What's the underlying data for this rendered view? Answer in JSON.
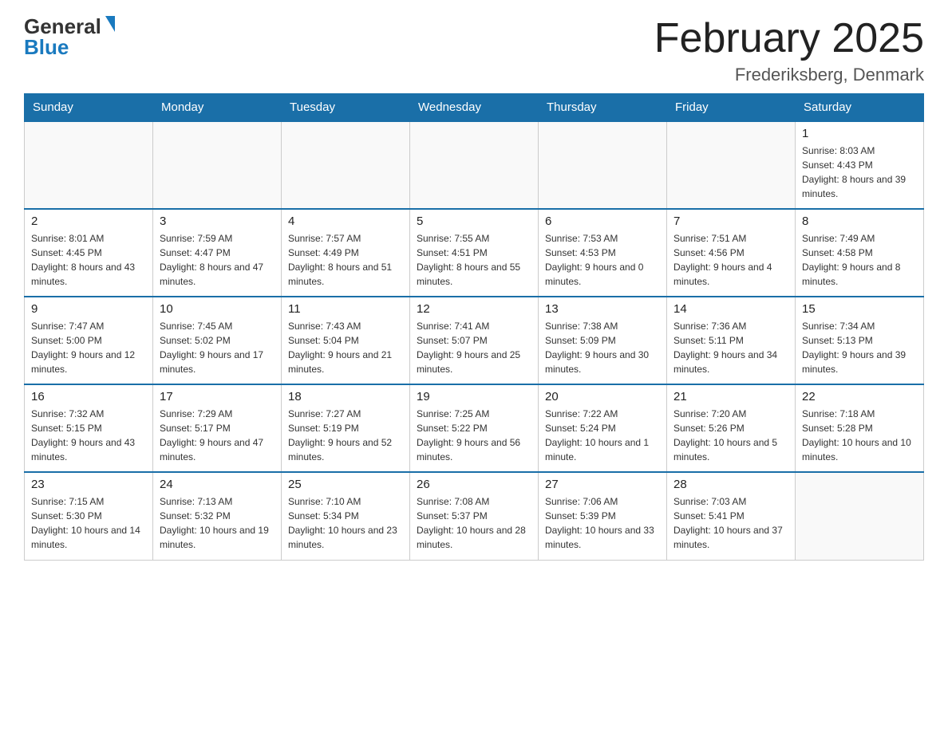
{
  "logo": {
    "general": "General",
    "blue": "Blue",
    "triangle": "▼"
  },
  "header": {
    "month_year": "February 2025",
    "location": "Frederiksberg, Denmark"
  },
  "days_of_week": [
    "Sunday",
    "Monday",
    "Tuesday",
    "Wednesday",
    "Thursday",
    "Friday",
    "Saturday"
  ],
  "weeks": [
    [
      {
        "day": "",
        "sunrise": "",
        "sunset": "",
        "daylight": "",
        "empty": true
      },
      {
        "day": "",
        "sunrise": "",
        "sunset": "",
        "daylight": "",
        "empty": true
      },
      {
        "day": "",
        "sunrise": "",
        "sunset": "",
        "daylight": "",
        "empty": true
      },
      {
        "day": "",
        "sunrise": "",
        "sunset": "",
        "daylight": "",
        "empty": true
      },
      {
        "day": "",
        "sunrise": "",
        "sunset": "",
        "daylight": "",
        "empty": true
      },
      {
        "day": "",
        "sunrise": "",
        "sunset": "",
        "daylight": "",
        "empty": true
      },
      {
        "day": "1",
        "sunrise": "Sunrise: 8:03 AM",
        "sunset": "Sunset: 4:43 PM",
        "daylight": "Daylight: 8 hours and 39 minutes.",
        "empty": false
      }
    ],
    [
      {
        "day": "2",
        "sunrise": "Sunrise: 8:01 AM",
        "sunset": "Sunset: 4:45 PM",
        "daylight": "Daylight: 8 hours and 43 minutes.",
        "empty": false
      },
      {
        "day": "3",
        "sunrise": "Sunrise: 7:59 AM",
        "sunset": "Sunset: 4:47 PM",
        "daylight": "Daylight: 8 hours and 47 minutes.",
        "empty": false
      },
      {
        "day": "4",
        "sunrise": "Sunrise: 7:57 AM",
        "sunset": "Sunset: 4:49 PM",
        "daylight": "Daylight: 8 hours and 51 minutes.",
        "empty": false
      },
      {
        "day": "5",
        "sunrise": "Sunrise: 7:55 AM",
        "sunset": "Sunset: 4:51 PM",
        "daylight": "Daylight: 8 hours and 55 minutes.",
        "empty": false
      },
      {
        "day": "6",
        "sunrise": "Sunrise: 7:53 AM",
        "sunset": "Sunset: 4:53 PM",
        "daylight": "Daylight: 9 hours and 0 minutes.",
        "empty": false
      },
      {
        "day": "7",
        "sunrise": "Sunrise: 7:51 AM",
        "sunset": "Sunset: 4:56 PM",
        "daylight": "Daylight: 9 hours and 4 minutes.",
        "empty": false
      },
      {
        "day": "8",
        "sunrise": "Sunrise: 7:49 AM",
        "sunset": "Sunset: 4:58 PM",
        "daylight": "Daylight: 9 hours and 8 minutes.",
        "empty": false
      }
    ],
    [
      {
        "day": "9",
        "sunrise": "Sunrise: 7:47 AM",
        "sunset": "Sunset: 5:00 PM",
        "daylight": "Daylight: 9 hours and 12 minutes.",
        "empty": false
      },
      {
        "day": "10",
        "sunrise": "Sunrise: 7:45 AM",
        "sunset": "Sunset: 5:02 PM",
        "daylight": "Daylight: 9 hours and 17 minutes.",
        "empty": false
      },
      {
        "day": "11",
        "sunrise": "Sunrise: 7:43 AM",
        "sunset": "Sunset: 5:04 PM",
        "daylight": "Daylight: 9 hours and 21 minutes.",
        "empty": false
      },
      {
        "day": "12",
        "sunrise": "Sunrise: 7:41 AM",
        "sunset": "Sunset: 5:07 PM",
        "daylight": "Daylight: 9 hours and 25 minutes.",
        "empty": false
      },
      {
        "day": "13",
        "sunrise": "Sunrise: 7:38 AM",
        "sunset": "Sunset: 5:09 PM",
        "daylight": "Daylight: 9 hours and 30 minutes.",
        "empty": false
      },
      {
        "day": "14",
        "sunrise": "Sunrise: 7:36 AM",
        "sunset": "Sunset: 5:11 PM",
        "daylight": "Daylight: 9 hours and 34 minutes.",
        "empty": false
      },
      {
        "day": "15",
        "sunrise": "Sunrise: 7:34 AM",
        "sunset": "Sunset: 5:13 PM",
        "daylight": "Daylight: 9 hours and 39 minutes.",
        "empty": false
      }
    ],
    [
      {
        "day": "16",
        "sunrise": "Sunrise: 7:32 AM",
        "sunset": "Sunset: 5:15 PM",
        "daylight": "Daylight: 9 hours and 43 minutes.",
        "empty": false
      },
      {
        "day": "17",
        "sunrise": "Sunrise: 7:29 AM",
        "sunset": "Sunset: 5:17 PM",
        "daylight": "Daylight: 9 hours and 47 minutes.",
        "empty": false
      },
      {
        "day": "18",
        "sunrise": "Sunrise: 7:27 AM",
        "sunset": "Sunset: 5:19 PM",
        "daylight": "Daylight: 9 hours and 52 minutes.",
        "empty": false
      },
      {
        "day": "19",
        "sunrise": "Sunrise: 7:25 AM",
        "sunset": "Sunset: 5:22 PM",
        "daylight": "Daylight: 9 hours and 56 minutes.",
        "empty": false
      },
      {
        "day": "20",
        "sunrise": "Sunrise: 7:22 AM",
        "sunset": "Sunset: 5:24 PM",
        "daylight": "Daylight: 10 hours and 1 minute.",
        "empty": false
      },
      {
        "day": "21",
        "sunrise": "Sunrise: 7:20 AM",
        "sunset": "Sunset: 5:26 PM",
        "daylight": "Daylight: 10 hours and 5 minutes.",
        "empty": false
      },
      {
        "day": "22",
        "sunrise": "Sunrise: 7:18 AM",
        "sunset": "Sunset: 5:28 PM",
        "daylight": "Daylight: 10 hours and 10 minutes.",
        "empty": false
      }
    ],
    [
      {
        "day": "23",
        "sunrise": "Sunrise: 7:15 AM",
        "sunset": "Sunset: 5:30 PM",
        "daylight": "Daylight: 10 hours and 14 minutes.",
        "empty": false
      },
      {
        "day": "24",
        "sunrise": "Sunrise: 7:13 AM",
        "sunset": "Sunset: 5:32 PM",
        "daylight": "Daylight: 10 hours and 19 minutes.",
        "empty": false
      },
      {
        "day": "25",
        "sunrise": "Sunrise: 7:10 AM",
        "sunset": "Sunset: 5:34 PM",
        "daylight": "Daylight: 10 hours and 23 minutes.",
        "empty": false
      },
      {
        "day": "26",
        "sunrise": "Sunrise: 7:08 AM",
        "sunset": "Sunset: 5:37 PM",
        "daylight": "Daylight: 10 hours and 28 minutes.",
        "empty": false
      },
      {
        "day": "27",
        "sunrise": "Sunrise: 7:06 AM",
        "sunset": "Sunset: 5:39 PM",
        "daylight": "Daylight: 10 hours and 33 minutes.",
        "empty": false
      },
      {
        "day": "28",
        "sunrise": "Sunrise: 7:03 AM",
        "sunset": "Sunset: 5:41 PM",
        "daylight": "Daylight: 10 hours and 37 minutes.",
        "empty": false
      },
      {
        "day": "",
        "sunrise": "",
        "sunset": "",
        "daylight": "",
        "empty": true
      }
    ]
  ]
}
